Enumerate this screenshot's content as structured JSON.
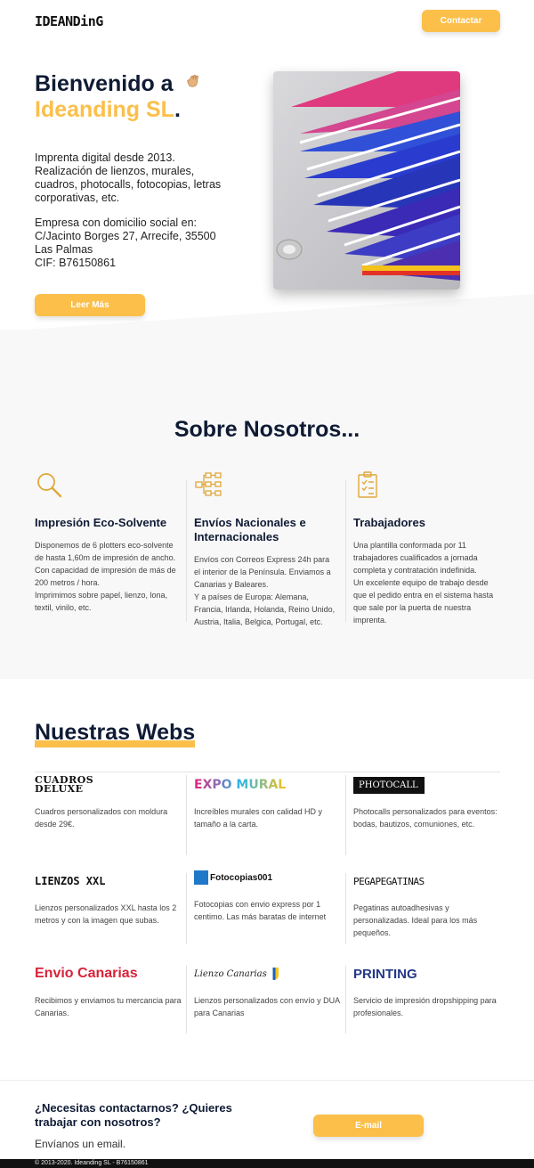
{
  "header": {
    "logo_text": "IDEANDinG",
    "contact_label": "Contactar"
  },
  "hero": {
    "title_prefix": "Bienvenido a",
    "brand": "Ideanding SL",
    "brand_suffix": ".",
    "description": "Imprenta digital desde 2013. Realización de lienzos, murales, cuadros, photocalls, fotocopias, letras corporativas, etc.",
    "address_lines": [
      "Empresa con domicilio social en:",
      "C/Jacinto Borges 27, Arrecife, 35500",
      "Las Palmas",
      "CIF: B76150861"
    ],
    "read_more_label": "Leer Más"
  },
  "about": {
    "title": "Sobre Nosotros...",
    "columns": [
      {
        "icon": "magnifier-icon",
        "heading": "Impresión Eco-Solvente",
        "text": "Disponemos de 6 plotters eco-solvente de hasta 1,60m de impresión de ancho. Con capacidad de impresión de más de 200 metros / hora.",
        "text2": "Imprimimos sobre papel, lienzo, lona, textil, vinilo, etc."
      },
      {
        "icon": "network-icon",
        "heading": "Envíos Nacionales e Internacionales",
        "text": "Envíos con Correos Express 24h para el interior de la Península. Enviamos a Canarias y Baleares.",
        "text2": "Y a países de Europa: Alemana, Francia, Irlanda, Holanda, Reino Unido, Austria, Italia, Belgica, Portugal, etc."
      },
      {
        "icon": "clipboard-icon",
        "heading": "Trabajadores",
        "text": "Una plantilla conformada por 11 trabajadores cualificados a jornada completa y contratación indefinida.",
        "text2": "Un excelente equipo de trabajo desde que el pedido entra en el sistema hasta que sale por la puerta de nuestra imprenta."
      }
    ]
  },
  "webs": {
    "title": "Nuestras Webs",
    "items": [
      {
        "logo": "CUADROS DELUXE",
        "text": "Cuadros personalizados con moldura desde 29€."
      },
      {
        "logo": "EXPO MURAL",
        "text": "Increíbles murales con calidad HD y tamaño a la carta."
      },
      {
        "logo": "PHOTOCALL",
        "text": "Photocalls personalizados para eventos: bodas, bautizos, comuniones, etc."
      },
      {
        "logo": "LIENZOS XXL",
        "text": "Lienzos personalizados XXL hasta los 2 metros y con la imagen que subas."
      },
      {
        "logo": "Fotocopias001",
        "text": "Fotocopias con envio express por 1 centimo. Las más baratas de internet"
      },
      {
        "logo": "PEGAPEGATINAS",
        "text": "Pegatinas autoadhesivas y personalizadas. Ideal para los más pequeños."
      },
      {
        "logo": "Envio Canarias",
        "text": "Recibimos y enviamos tu mercancia para Canarias."
      },
      {
        "logo": "Lienzo Canarias",
        "text": "Lienzos personalizados con envío y DUA para Canarias"
      },
      {
        "logo": "PRINTING",
        "text": "Servicio de impresión dropshipping para profesionales."
      }
    ]
  },
  "contact": {
    "question": "¿Necesitas contactarnos? ¿Quieres trabajar con nosotros?",
    "subtitle": "Envíanos un email.",
    "email_label": "E-mail"
  },
  "footer": {
    "text": "© 2013-2020. Ideanding SL - B76150861"
  },
  "colors": {
    "accent": "#fbbf4a",
    "navy": "#0f1b34"
  }
}
